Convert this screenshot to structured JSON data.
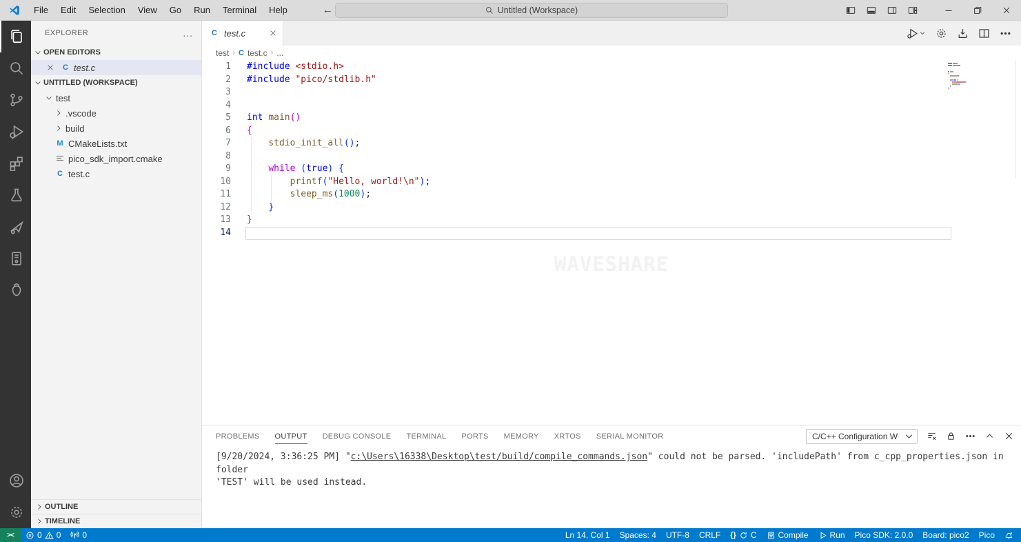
{
  "window": {
    "search_label": "Untitled (Workspace)",
    "menu_items": [
      "File",
      "Edit",
      "Selection",
      "View",
      "Go",
      "Run",
      "Terminal",
      "Help"
    ],
    "layout_controls": [
      "layout-sidebar-left",
      "layout-panel",
      "layout-sidebar-right",
      "layout-grid"
    ],
    "window_controls": [
      "minimize",
      "restore",
      "close"
    ]
  },
  "activity_bar": {
    "top": [
      {
        "name": "explorer",
        "icon": "files",
        "active": true
      },
      {
        "name": "search",
        "icon": "search",
        "active": false
      },
      {
        "name": "source-control",
        "icon": "source-control",
        "active": false
      },
      {
        "name": "run-and-debug",
        "icon": "debug",
        "active": false
      },
      {
        "name": "extensions",
        "icon": "extensions",
        "active": false
      },
      {
        "name": "testing",
        "icon": "beaker",
        "active": false
      },
      {
        "name": "pico-project",
        "icon": "paper-plane",
        "active": false
      },
      {
        "name": "dev-board",
        "icon": "board",
        "active": false
      },
      {
        "name": "raspberry-pi",
        "icon": "raspberry",
        "active": false
      }
    ],
    "bottom": [
      {
        "name": "accounts",
        "icon": "account",
        "active": false
      },
      {
        "name": "settings",
        "icon": "gear",
        "active": false
      }
    ]
  },
  "sidebar": {
    "title": "EXPLORER",
    "more": "...",
    "open_editors_label": "OPEN EDITORS",
    "open_editors": [
      {
        "label": "test.c",
        "icon": "c",
        "selected": true
      }
    ],
    "workspace_label": "UNTITLED (WORKSPACE)",
    "tree": [
      {
        "label": "test",
        "kind": "folder-open",
        "indent": 0
      },
      {
        "label": ".vscode",
        "kind": "folder",
        "indent": 1
      },
      {
        "label": "build",
        "kind": "folder",
        "indent": 1
      },
      {
        "label": "CMakeLists.txt",
        "kind": "cmake",
        "indent": 1
      },
      {
        "label": "pico_sdk_import.cmake",
        "kind": "lines",
        "indent": 1
      },
      {
        "label": "test.c",
        "kind": "c",
        "indent": 1
      }
    ],
    "outline_label": "OUTLINE",
    "timeline_label": "TIMELINE"
  },
  "editor": {
    "tab": {
      "label": "test.c",
      "icon": "c"
    },
    "toolbar": [
      "run-debug",
      "gear",
      "flash",
      "split",
      "more"
    ],
    "breadcrumbs": [
      "test",
      "test.c",
      "..."
    ],
    "watermark": "WAVESHARE",
    "code_lines": [
      {
        "n": "1",
        "tokens": [
          [
            "dir",
            "#include"
          ],
          [
            "pl",
            " "
          ],
          [
            "inc",
            "<stdio.h>"
          ]
        ]
      },
      {
        "n": "2",
        "tokens": [
          [
            "dir",
            "#include"
          ],
          [
            "pl",
            " "
          ],
          [
            "inc",
            "\"pico/stdlib.h\""
          ]
        ]
      },
      {
        "n": "3",
        "tokens": []
      },
      {
        "n": "4",
        "tokens": []
      },
      {
        "n": "5",
        "tokens": [
          [
            "kw",
            "int"
          ],
          [
            "pl",
            " "
          ],
          [
            "fn",
            "main"
          ],
          [
            "br1",
            "()"
          ]
        ]
      },
      {
        "n": "6",
        "tokens": [
          [
            "br1",
            "{"
          ]
        ]
      },
      {
        "n": "7",
        "tokens": [
          [
            "pl",
            "    "
          ],
          [
            "fn",
            "stdio_init_all"
          ],
          [
            "br2",
            "()"
          ],
          [
            "pl",
            ";"
          ]
        ]
      },
      {
        "n": "8",
        "tokens": []
      },
      {
        "n": "9",
        "tokens": [
          [
            "pl",
            "    "
          ],
          [
            "ctrl",
            "while"
          ],
          [
            "pl",
            " "
          ],
          [
            "br2",
            "("
          ],
          [
            "kw",
            "true"
          ],
          [
            "br2",
            ")"
          ],
          [
            "pl",
            " "
          ],
          [
            "br2",
            "{"
          ]
        ]
      },
      {
        "n": "10",
        "tokens": [
          [
            "pl",
            "        "
          ],
          [
            "fn",
            "printf"
          ],
          [
            "br2",
            "("
          ],
          [
            "str",
            "\"Hello, world!\\n\""
          ],
          [
            "br2",
            ")"
          ],
          [
            "pl",
            ";"
          ]
        ]
      },
      {
        "n": "11",
        "tokens": [
          [
            "pl",
            "        "
          ],
          [
            "fn",
            "sleep_ms"
          ],
          [
            "br2",
            "("
          ],
          [
            "num",
            "1000"
          ],
          [
            "br2",
            ")"
          ],
          [
            "pl",
            ";"
          ]
        ]
      },
      {
        "n": "12",
        "tokens": [
          [
            "pl",
            "    "
          ],
          [
            "br2",
            "}"
          ]
        ]
      },
      {
        "n": "13",
        "tokens": [
          [
            "br1",
            "}"
          ]
        ]
      },
      {
        "n": "14",
        "tokens": [],
        "current": true
      }
    ]
  },
  "panel": {
    "tabs": [
      "PROBLEMS",
      "OUTPUT",
      "DEBUG CONSOLE",
      "TERMINAL",
      "PORTS",
      "MEMORY",
      "XRTOS",
      "SERIAL MONITOR"
    ],
    "active_tab": "OUTPUT",
    "config_dropdown_value": "C/C++ Configuration W",
    "actions": [
      "clear-output",
      "lock",
      "more",
      "chevron-up",
      "close"
    ],
    "output": {
      "line1_prefix": "[9/20/2024, 3:36:25 PM] \"",
      "line1_link": "c:\\Users\\16338\\Desktop\\test/build/compile_commands.json",
      "line1_suffix": "\" could not be parsed. 'includePath' from c_cpp_properties.json in folder",
      "line2": "'TEST' will be used instead."
    }
  },
  "status_bar": {
    "remote_label": "><",
    "left": [
      {
        "name": "problems",
        "parts": [
          {
            "icon": "error"
          },
          {
            "text": "0"
          },
          {
            "icon": "warning"
          },
          {
            "text": "0"
          }
        ]
      },
      {
        "name": "ports-count",
        "parts": [
          {
            "icon": "antenna"
          },
          {
            "text": "0"
          }
        ]
      }
    ],
    "right": [
      {
        "name": "cursor-position",
        "label": "Ln 14, Col 1"
      },
      {
        "name": "indentation",
        "label": "Spaces: 4"
      },
      {
        "name": "encoding",
        "label": "UTF-8"
      },
      {
        "name": "eol",
        "label": "CRLF"
      },
      {
        "name": "language-status",
        "braces": "{}",
        "icon": "sync",
        "label": "C"
      },
      {
        "name": "compile",
        "icon": "chip",
        "label": "Compile"
      },
      {
        "name": "run",
        "icon": "play",
        "label": "Run"
      },
      {
        "name": "pico-sdk-version",
        "label": "Pico SDK: 2.0.0"
      },
      {
        "name": "board",
        "label": "Board: pico2"
      },
      {
        "name": "pico",
        "label": "Pico"
      },
      {
        "name": "notifications",
        "icon": "bell",
        "label": ""
      }
    ]
  }
}
